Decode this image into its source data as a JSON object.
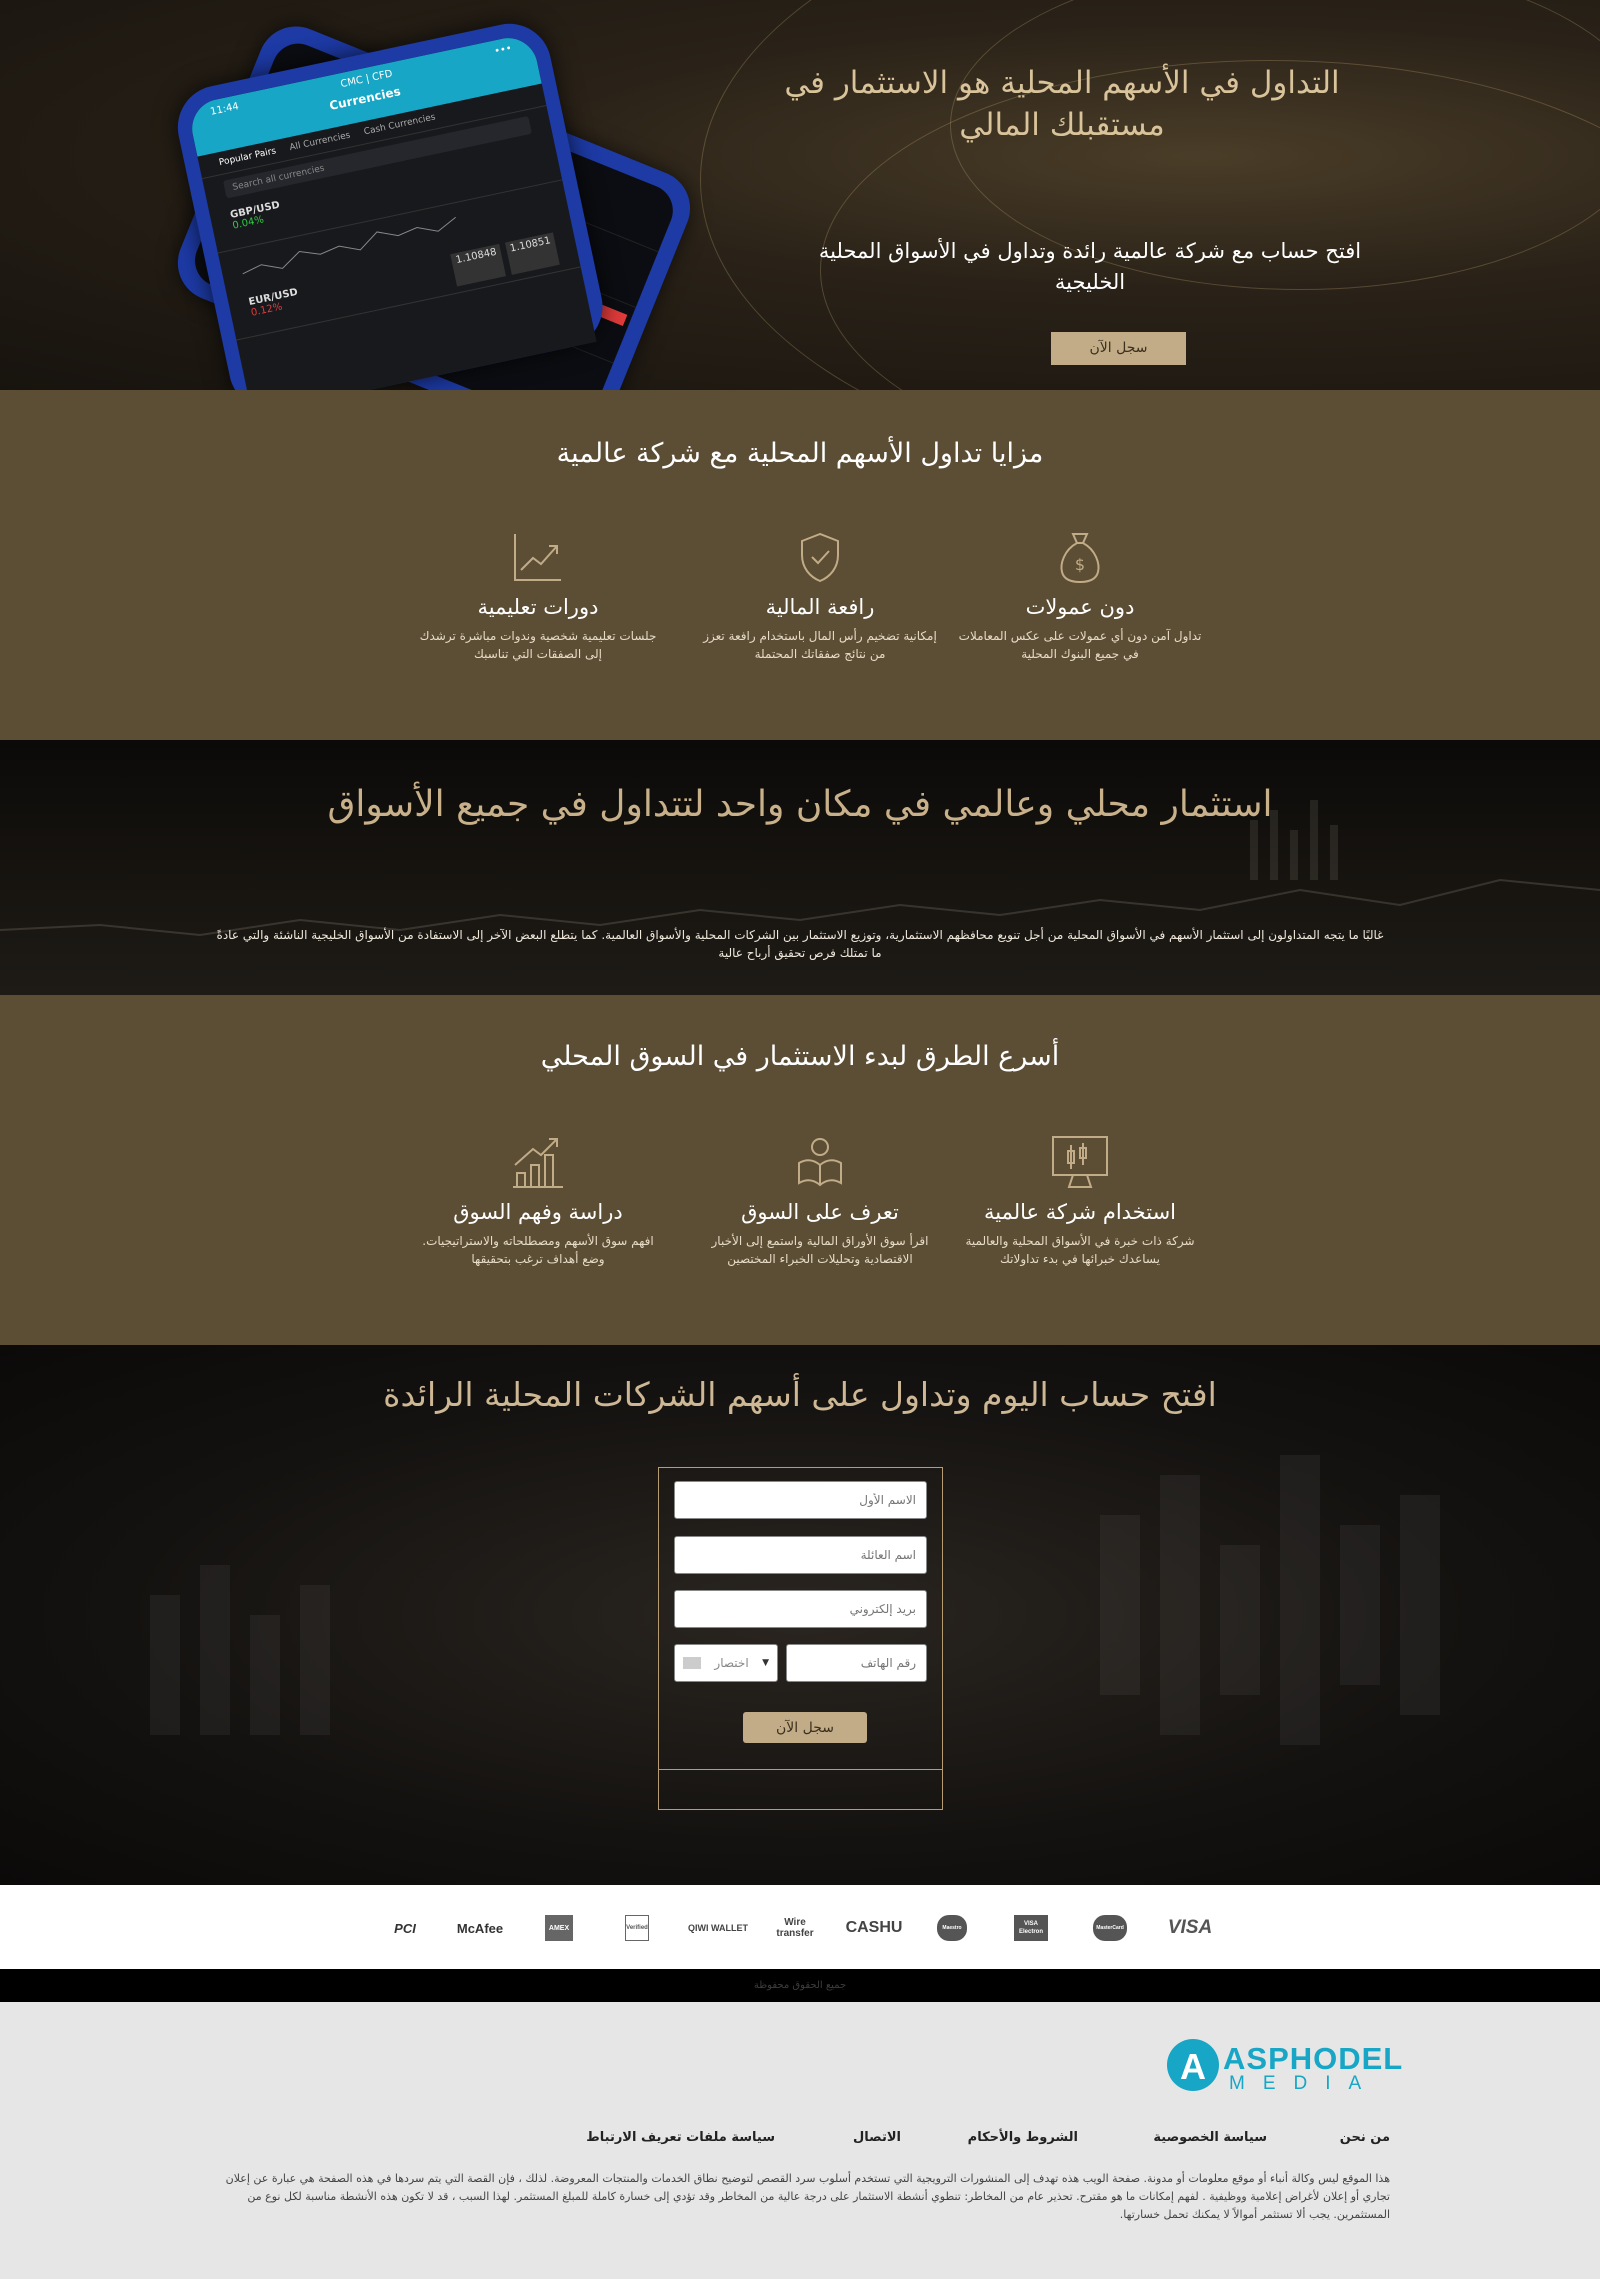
{
  "hero": {
    "title": "التداول في الأسهم المحلية هو الاستثمار في مستقبلك المالي",
    "subtitle": "افتح حساب مع شركة عالمية رائدة وتداول في الأسواق المحلية الخليجية",
    "button": "سجل الآن",
    "phone": {
      "time": "11:44",
      "header": "Currencies",
      "app": "CMC | CFD",
      "tabs": [
        "Popular Pairs",
        "All Currencies",
        "Cash Currencies"
      ],
      "search_placeholder": "Search all currencies",
      "pair1": "GBP/USD",
      "pair1_change": "0.04%",
      "pair2": "EUR/USD",
      "pair2_change": "0.12%",
      "pair2_sell": "1.10848",
      "pair2_buy": "1.10851"
    }
  },
  "features": {
    "title": "مزايا تداول الأسهم المحلية مع شركة عالمية",
    "items": [
      {
        "icon": "money-bag-icon",
        "title": "دون عمولات",
        "text": "تداول آمن دون أي عمولات على عكس المعاملات في جميع البنوك المحلية"
      },
      {
        "icon": "shield-check-icon",
        "title": "رافعة المالية",
        "text": "إمكانية تضخيم رأس المال باستخدام رافعة تعزز من نتائج صفقاتك المحتملة"
      },
      {
        "icon": "chart-trend-icon",
        "title": "دورات تعليمية",
        "text": "جلسات تعليمية شخصية وندوات مباشرة ترشدك إلى الصفقات التي تناسبك"
      }
    ]
  },
  "invest": {
    "title": "استثمار محلي وعالمي في مكان واحد لتتداول في جميع الأسواق",
    "text": "غالبًا ما يتجه المتداولون إلى استثمار الأسهم في الأسواق المحلية من أجل تنويع محافظهم الاستثمارية، وتوزيع الاستثمار بين الشركات المحلية والأسواق العالمية. كما يتطلع البعض الآخر إلى الاستفادة من الأسواق الخليجية الناشئة والتي عادةً ما تمتلك فرص تحقيق أرباح عالية"
  },
  "fastest": {
    "title": "أسرع الطرق لبدء الاستثمار في السوق المحلي",
    "items": [
      {
        "icon": "monitor-candles-icon",
        "title": "استخدام شركة عالمية",
        "text": "شركة ذات خبرة في الأسواق المحلية والعالمية يساعدك خبرائها في بدء تداولاتك"
      },
      {
        "icon": "reader-icon",
        "title": "تعرف على السوق",
        "text": "اقرأ سوق الأوراق المالية واستمع إلى الأخبار الاقتصادية وتحليلات الخبراء المختصين"
      },
      {
        "icon": "growth-chart-icon",
        "title": "دراسة وفهم السوق",
        "text": "افهم سوق الأسهم ومصطلحاته والاستراتيجيات. وضع أهداف ترغب بتحقيقها"
      }
    ]
  },
  "signup": {
    "title": "افتح حساب اليوم وتداول على أسهم الشركات المحلية الرائدة",
    "first_name": "الاسم الأول",
    "last_name": "اسم العائلة",
    "email": "بريد إلكتروني",
    "phone": "رقم الهاتف",
    "prefix": "اختصار",
    "button": "سجل الآن"
  },
  "payments": [
    "PCI",
    "McAfee",
    "AMEX",
    "Verified",
    "QIWI WALLET",
    "Wire transfer",
    "CASHU",
    "Maestro",
    "VISA Electron",
    "MasterCard",
    "VISA"
  ],
  "copyright": "جميع الحقوق محفوظة",
  "footer": {
    "logo_top": "ASPHODEL",
    "logo_bottom": "MEDIA",
    "logo_letter": "A",
    "links": [
      "من نحن",
      "سياسة الخصوصية",
      "الشروط والأحكام",
      "الاتصال",
      "سياسة ملفات تعريف الارتباط"
    ],
    "disclaimer": "هذا الموقع ليس وكالة أنباء أو موقع معلومات أو مدونة. صفحة الويب هذه تهدف إلى المنشورات الترويجية التي تستخدم أسلوب سرد القصص لتوضيح نطاق الخدمات والمنتجات المعروضة. لذلك ، فإن القصة التي يتم سردها في هذه الصفحة هي عبارة عن إعلان تجاري أو إعلان لأغراض إعلامية ووظيفية . لفهم إمكانات ما هو مقترح. تحذير عام من المخاطر: تنطوي أنشطة الاستثمار على درجة عالية من المخاطر وقد تؤدي إلى خسارة كاملة للمبلغ المستثمر. لهذا السبب ، قد لا تكون هذه الأنشطة مناسبة لكل نوع من المستثمرين. يجب ألا تستثمر أموالاً لا يمكنك تحمل خسارتها."
  },
  "colors": {
    "brown": "#5c4d35",
    "gold": "#c2ac87",
    "hero_title": "#d8c39a",
    "logo": "#17a6c6"
  }
}
